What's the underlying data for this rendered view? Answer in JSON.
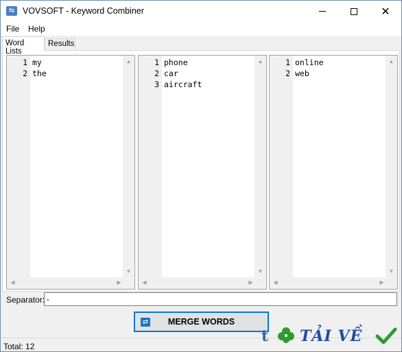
{
  "window": {
    "title": "VOVSOFT - Keyword Combiner",
    "icon": "app-icon"
  },
  "menu": {
    "file": "File",
    "help": "Help"
  },
  "tabs": {
    "word_lists": "Word Lists",
    "results": "Results"
  },
  "lists": [
    {
      "lines": [
        {
          "num": "1",
          "text": "my"
        },
        {
          "num": "2",
          "text": "the"
        }
      ]
    },
    {
      "lines": [
        {
          "num": "1",
          "text": "phone"
        },
        {
          "num": "2",
          "text": "car"
        },
        {
          "num": "3",
          "text": "aircraft"
        }
      ]
    },
    {
      "lines": [
        {
          "num": "1",
          "text": "online"
        },
        {
          "num": "2",
          "text": "web"
        }
      ]
    }
  ],
  "separator": {
    "label": "Separator:",
    "value": "-"
  },
  "merge_button": {
    "label": "MERGE WORDS",
    "icon": "shuffle-icon"
  },
  "status": {
    "text": "Total: 12"
  },
  "watermark": {
    "prefix": "t",
    "text": "TẢI VỀ"
  },
  "colors": {
    "accent": "#0078d7",
    "watermark": "#1f4b9e",
    "clover": "#2e9b2e"
  }
}
